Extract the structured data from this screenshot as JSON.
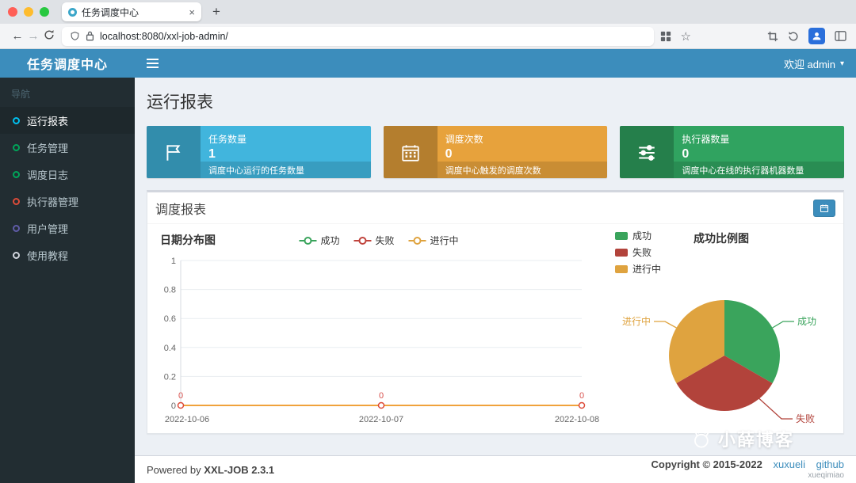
{
  "browser": {
    "tab_title": "任务调度中心",
    "url": "localhost:8080/xxl-job-admin/"
  },
  "sidebar": {
    "logo": "任务调度中心",
    "nav_label": "导航",
    "menu": [
      {
        "label": "运行报表",
        "icon_color": "#00c0ef",
        "active": true
      },
      {
        "label": "任务管理",
        "icon_color": "#00a65a",
        "active": false
      },
      {
        "label": "调度日志",
        "icon_color": "#00a65a",
        "active": false
      },
      {
        "label": "执行器管理",
        "icon_color": "#dd4b39",
        "active": false
      },
      {
        "label": "用户管理",
        "icon_color": "#605ca8",
        "active": false
      },
      {
        "label": "使用教程",
        "icon_color": "#d2d6de",
        "active": false
      }
    ]
  },
  "header": {
    "welcome": "欢迎 admin"
  },
  "page": {
    "title": "运行报表"
  },
  "stats": [
    {
      "title": "任务数量",
      "value": "1",
      "desc": "调度中心运行的任务数量",
      "color": "#41b5dd",
      "icon": "flag-icon"
    },
    {
      "title": "调度次数",
      "value": "0",
      "desc": "调度中心触发的调度次数",
      "color": "#e7a23c",
      "icon": "calendar-icon"
    },
    {
      "title": "执行器数量",
      "value": "0",
      "desc": "调度中心在线的执行器机器数量",
      "color": "#30a360",
      "icon": "sliders-icon"
    }
  ],
  "report": {
    "panel_title": "调度报表"
  },
  "chart_data": [
    {
      "type": "line",
      "title": "日期分布图",
      "legend": [
        "成功",
        "失败",
        "进行中"
      ],
      "legend_colors": [
        "#3aa45c",
        "#c0443d",
        "#dfa33f"
      ],
      "legend_position": "top-center",
      "grid": true,
      "x": [
        "2022-10-06",
        "2022-10-07",
        "2022-10-08"
      ],
      "series": [
        {
          "name": "成功",
          "values": [
            0,
            0,
            0
          ]
        },
        {
          "name": "失败",
          "values": [
            0,
            0,
            0
          ]
        },
        {
          "name": "进行中",
          "values": [
            0,
            0,
            0
          ]
        }
      ],
      "ylim": [
        0,
        1
      ],
      "yticks": [
        "1",
        "0.8",
        "0.6",
        "0.4",
        "0.2",
        "0"
      ],
      "point_labels": [
        "0",
        "0",
        "0"
      ]
    },
    {
      "type": "pie",
      "title": "成功比例图",
      "legend_position": "top-left",
      "slices": [
        {
          "label": "成功",
          "value": 1,
          "color": "#3aa45c"
        },
        {
          "label": "失败",
          "value": 1,
          "color": "#b2433b"
        },
        {
          "label": "进行中",
          "value": 1,
          "color": "#dfa33f"
        }
      ]
    }
  ],
  "footer": {
    "powered": "Powered by",
    "version": "XXL-JOB 2.3.1",
    "copyright": "Copyright © 2015-2022",
    "link_author": "xuxueli",
    "link_github": "github",
    "sub": "xueqimiao"
  },
  "watermark": "小薛博客"
}
